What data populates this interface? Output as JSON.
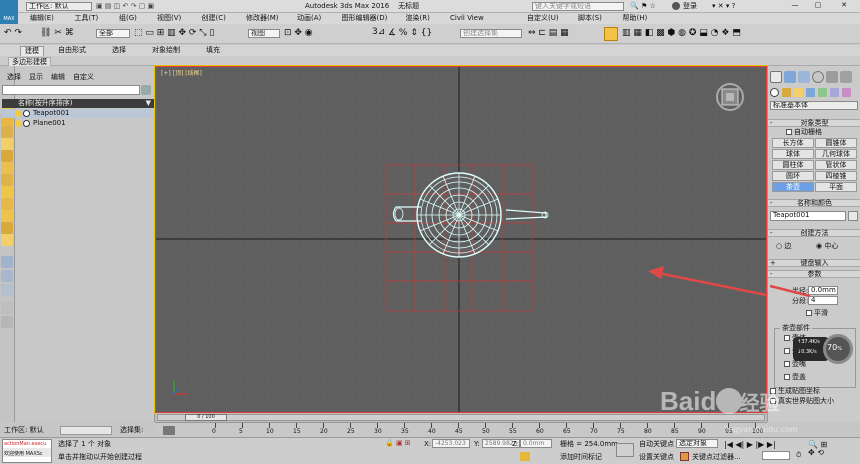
{
  "title": {
    "workspace_label": "工作区: 默认",
    "app": "Autodesk 3ds Max 2016",
    "doc": "无标题",
    "search_placeholder": "键入关键字或短语",
    "user": "登录",
    "logo": "MAX"
  },
  "menu": {
    "items": [
      "编辑(E)",
      "工具(T)",
      "组(G)",
      "视图(V)",
      "创建(C)",
      "修改器(M)",
      "动画(A)",
      "图形编辑器(D)",
      "渲染(R)",
      "Civil View",
      "自定义(U)",
      "脚本(S)",
      "帮助(H)"
    ]
  },
  "toolbar": {
    "filter_select": "全部",
    "view_select": "视图",
    "selection_set": "创建选择集",
    "snap_number": "3"
  },
  "ribbon": {
    "tabs": [
      "建模",
      "自由形式",
      "选择",
      "对象绘制",
      "填充"
    ],
    "subtab": "多边形建模"
  },
  "scene_explorer": {
    "menu": [
      "选择",
      "显示",
      "编辑",
      "自定义"
    ],
    "column_header": "名称(按升序排序)",
    "items": [
      "Teapot001",
      "Plane001"
    ]
  },
  "viewport": {
    "label": "[+] [顶] [线框]"
  },
  "command_panel": {
    "category_select": "标准基本体",
    "object_type": {
      "header": "对象类型",
      "autogrid": "自动栅格",
      "buttons": [
        "长方体",
        "圆锥体",
        "球体",
        "几何球体",
        "圆柱体",
        "管状体",
        "圆环",
        "四棱锥",
        "茶壶",
        "平面"
      ]
    },
    "name_color": {
      "header": "名称和颜色",
      "name_value": "Teapot001"
    },
    "creation_method": {
      "header": "创建方法",
      "option1": "边",
      "option2": "中心"
    },
    "keyboard_entry": "键盘输入",
    "parameters": {
      "header": "参数",
      "radius_label": "半径:",
      "radius_value": "0.0mm",
      "segments_label": "分段:",
      "segments_value": "4",
      "smooth": "平滑",
      "parts_header": "茶壶部件",
      "parts": [
        "壶体",
        "壶把",
        "壶嘴",
        "壶盖"
      ],
      "gen_mapping": "生成贴图坐标",
      "real_world": "真实世界贴图大小"
    }
  },
  "badge": {
    "percent": "70",
    "percent_unit": "%",
    "up_speed": "37.4K/s",
    "down_speed": "0.3K/s"
  },
  "timebar": {
    "range": "0 / 100"
  },
  "timeline_ticks": [
    "0",
    "5",
    "10",
    "15",
    "20",
    "25",
    "30",
    "35",
    "40",
    "45",
    "50",
    "55",
    "60",
    "65",
    "70",
    "75",
    "80",
    "85",
    "90",
    "95",
    "100"
  ],
  "status": {
    "workspace": "工作区: 默认",
    "select_set": "选择集:",
    "script_line1": "actionMan.execu",
    "script_line2": "欢迎使用 MAXSc",
    "selected": "选择了 1 个 对象",
    "prompt": "单击并拖动以开始创建过程",
    "x_label": "X:",
    "x_value": "-4253.023",
    "y_label": "Y:",
    "y_value": "2589.982n",
    "z_label": "Z:",
    "z_value": "0.0mm",
    "grid": "栅格 = 254.0mm",
    "add_time_tag": "添加时间标记",
    "auto_key": "自动关键点",
    "set_key": "设置关键点",
    "selected_obj": "选定对象",
    "key_filters": "关键点过滤器..."
  },
  "watermark": {
    "brand": "Baidu",
    "brand_cn": "经验",
    "url": "jingyan.baidu.com"
  },
  "colors": {
    "viewport_bg": "#5f5f5f",
    "teapot_wire": "#dfffff",
    "active_border": "#e23a3a",
    "arrow": "#e04848",
    "highlight_btn": "#6ea0e8"
  }
}
